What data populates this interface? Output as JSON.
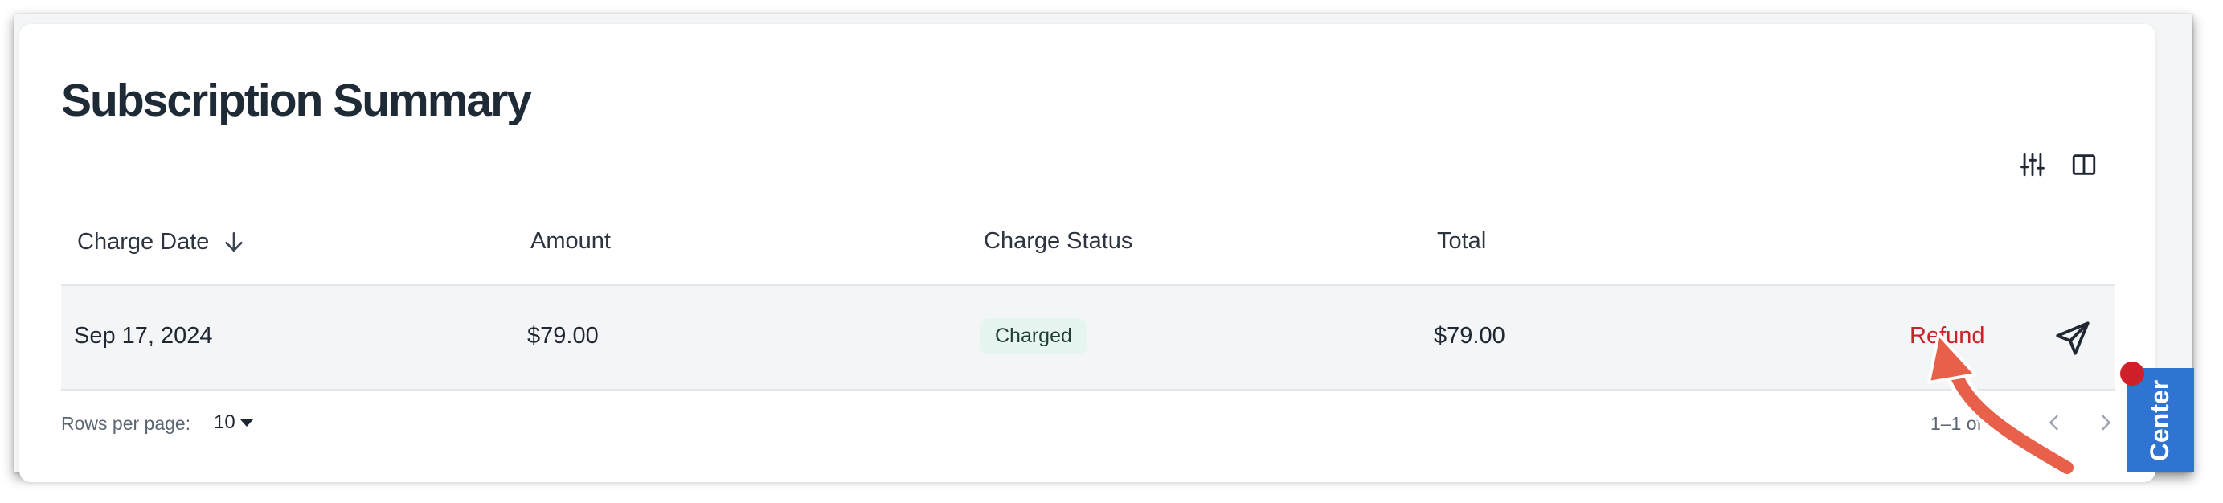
{
  "page": {
    "title": "Subscription Summary"
  },
  "toolbar": {
    "filter_icon": "sliders-icon",
    "columns_icon": "columns-icon"
  },
  "table": {
    "columns": [
      "Charge Date",
      "Amount",
      "Charge Status",
      "Total"
    ],
    "sort": {
      "column": "Charge Date",
      "direction": "descending",
      "icon": "arrow-down-icon"
    },
    "rows": [
      {
        "charge_date": "Sep 17, 2024",
        "amount": "$79.00",
        "charge_status": "Charged",
        "total": "$79.00",
        "action_label": "Refund",
        "send_icon": "send-icon"
      }
    ]
  },
  "pagination": {
    "rows_per_page_label": "Rows per page:",
    "rows_per_page_value": "10",
    "range_text": "1–1 of 1",
    "prev_icon": "chevron-left-icon",
    "next_icon": "chevron-right-icon"
  },
  "side_tab": {
    "label": "Center"
  },
  "colors": {
    "title": "#1f2a37",
    "row_bg": "#f4f5f6",
    "badge_bg": "#e6f5ef",
    "refund": "#c8232b",
    "side_tab": "#2f74d0",
    "notif_dot": "#d0202a",
    "annotation_arrow": "#e8604a"
  },
  "annotation": {
    "type": "curved-arrow",
    "target": "refund-button"
  }
}
